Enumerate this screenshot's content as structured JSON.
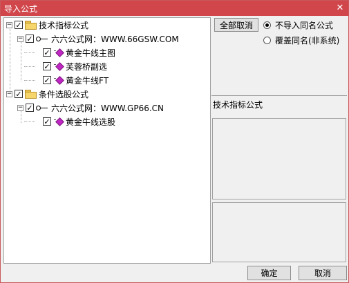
{
  "window": {
    "title": "导入公式",
    "close_glyph": "✕"
  },
  "tree": {
    "nodes": [
      {
        "label": "技术指标公式",
        "checked": true,
        "expanded": true,
        "kind": "folder"
      },
      {
        "label": "六六公式网：WWW.66GSW.COM",
        "checked": true,
        "expanded": true,
        "kind": "source"
      },
      {
        "label": "黄金牛线主图",
        "checked": true,
        "kind": "formula"
      },
      {
        "label": "芙蓉桥副选",
        "checked": true,
        "kind": "formula"
      },
      {
        "label": "黄金牛线FT",
        "checked": true,
        "kind": "formula"
      },
      {
        "label": "条件选股公式",
        "checked": true,
        "expanded": true,
        "kind": "folder"
      },
      {
        "label": "六六公式网：WWW.GP66.CN",
        "checked": true,
        "expanded": true,
        "kind": "source"
      },
      {
        "label": "黄金牛线选股",
        "checked": true,
        "kind": "formula"
      }
    ],
    "check_glyph": "✓",
    "collapse_glyph": "−"
  },
  "options": {
    "deselect_all_label": "全部取消",
    "radio_no_import": "不导入同名公式",
    "radio_overwrite": "覆盖同名(非系统)",
    "selected": "no_import"
  },
  "info": {
    "category_label": "技术指标公式"
  },
  "footer": {
    "ok_label": "确定",
    "cancel_label": "取消"
  }
}
